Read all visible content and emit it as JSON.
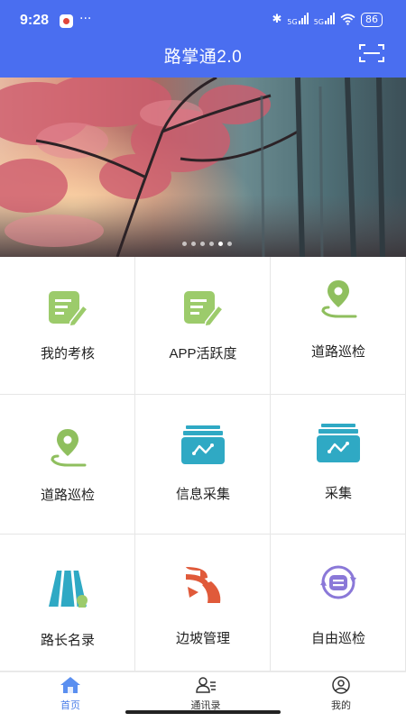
{
  "status_bar": {
    "time": "9:28",
    "more": "···",
    "network1": "5G",
    "network2": "5G",
    "battery": "86"
  },
  "header": {
    "title": "路掌通2.0",
    "scan_icon": "scan-icon",
    "color": "#4a6ef0"
  },
  "banner": {
    "pager_count": 6,
    "active_index": 4
  },
  "grid": [
    {
      "label": "我的考核",
      "icon": "clipboard-edit-icon"
    },
    {
      "label": "APP活跃度",
      "icon": "clipboard-edit-icon"
    },
    {
      "label": "道路巡检",
      "icon": "location-pin-icon"
    },
    {
      "label": "道路巡检",
      "icon": "location-pin-icon"
    },
    {
      "label": "信息采集",
      "icon": "collect-box-icon"
    },
    {
      "label": "采集",
      "icon": "collect-box-icon"
    },
    {
      "label": "路长名录",
      "icon": "road-icon"
    },
    {
      "label": "边坡管理",
      "icon": "slope-icon"
    },
    {
      "label": "自由巡检",
      "icon": "patrol-cycle-icon"
    }
  ],
  "tabbar": [
    {
      "label": "首页",
      "icon": "home-icon",
      "active": true
    },
    {
      "label": "通讯录",
      "icon": "contacts-icon",
      "active": false
    },
    {
      "label": "我的",
      "icon": "profile-icon",
      "active": false
    }
  ]
}
